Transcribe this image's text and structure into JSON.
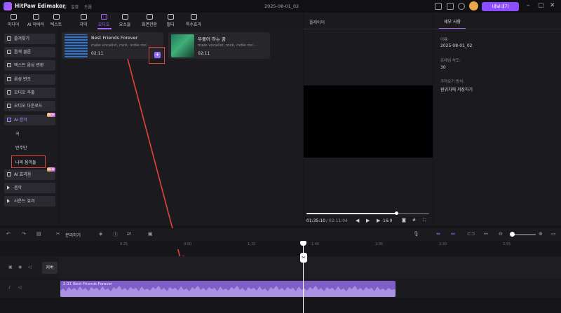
{
  "titlebar": {
    "app_name": "HitPaw Edimakor",
    "menu": [
      "파일",
      "설정",
      "도움"
    ],
    "project_name": "2025-08-01_02",
    "export_label": "내보내기",
    "window_controls": [
      "–",
      "▢",
      "✕"
    ]
  },
  "toolbar": {
    "tools": [
      {
        "label": "미디어",
        "icon": "media-icon"
      },
      {
        "label": "AI 아바타",
        "icon": "avatar-icon"
      },
      {
        "label": "텍스트",
        "icon": "text-icon"
      },
      {
        "label": "자막",
        "icon": "subtitle-icon"
      },
      {
        "label": "오디오",
        "icon": "audio-icon",
        "active": true
      },
      {
        "label": "요소들",
        "icon": "elements-icon"
      },
      {
        "label": "화면전환",
        "icon": "transition-icon"
      },
      {
        "label": "필터",
        "icon": "filter-icon"
      },
      {
        "label": "특수효과",
        "icon": "effects-icon"
      }
    ]
  },
  "sidebar": {
    "items": [
      {
        "label": "즐겨찾기"
      },
      {
        "label": "음색 클론"
      },
      {
        "label": "텍스트 음성 변환"
      },
      {
        "label": "음성 변조"
      },
      {
        "label": "오디오 추출"
      },
      {
        "label": "오디오 다운로드"
      }
    ],
    "ai_music": {
      "label": "AI 음악",
      "badge": "NEW"
    },
    "sub_items": [
      "곡",
      "반주만",
      "나의 음악들"
    ],
    "ai_effects": {
      "label": "AI 효과음",
      "badge": "NEW"
    },
    "music": {
      "label": "음악"
    },
    "sound": {
      "label": "사운드 효과"
    }
  },
  "media": {
    "cards": [
      {
        "title": "Best Friends Forever",
        "tags": "male vocalist, rock, indie roc...",
        "duration": "02:11"
      },
      {
        "title": "부풀어 하는 꿈",
        "tags": "male vocalist, rock, indie roc...",
        "duration": "02:11"
      }
    ],
    "add_label": "+"
  },
  "player": {
    "title": "플레이어",
    "current_time": "01:35:10",
    "total_time": "/ 02:11:04",
    "progress": 0.73,
    "ratio": "16:9"
  },
  "details": {
    "tab": "세부 사항",
    "name_label": "이름:",
    "name_value": "2025-08-01_02",
    "fps_label": "프레임 속도:",
    "fps_value": "30",
    "save_label": "가져오기 방식:",
    "save_value": "원위치에 저장하기"
  },
  "timeline": {
    "split_label": "분리하기",
    "ruler_ticks": [
      "0:25",
      "0:50",
      "1:15",
      "1:40",
      "2:05",
      "2:30",
      "2:55"
    ],
    "cover_label": "커버",
    "audio_clip_label": "2:11 Best Friends Forever"
  }
}
